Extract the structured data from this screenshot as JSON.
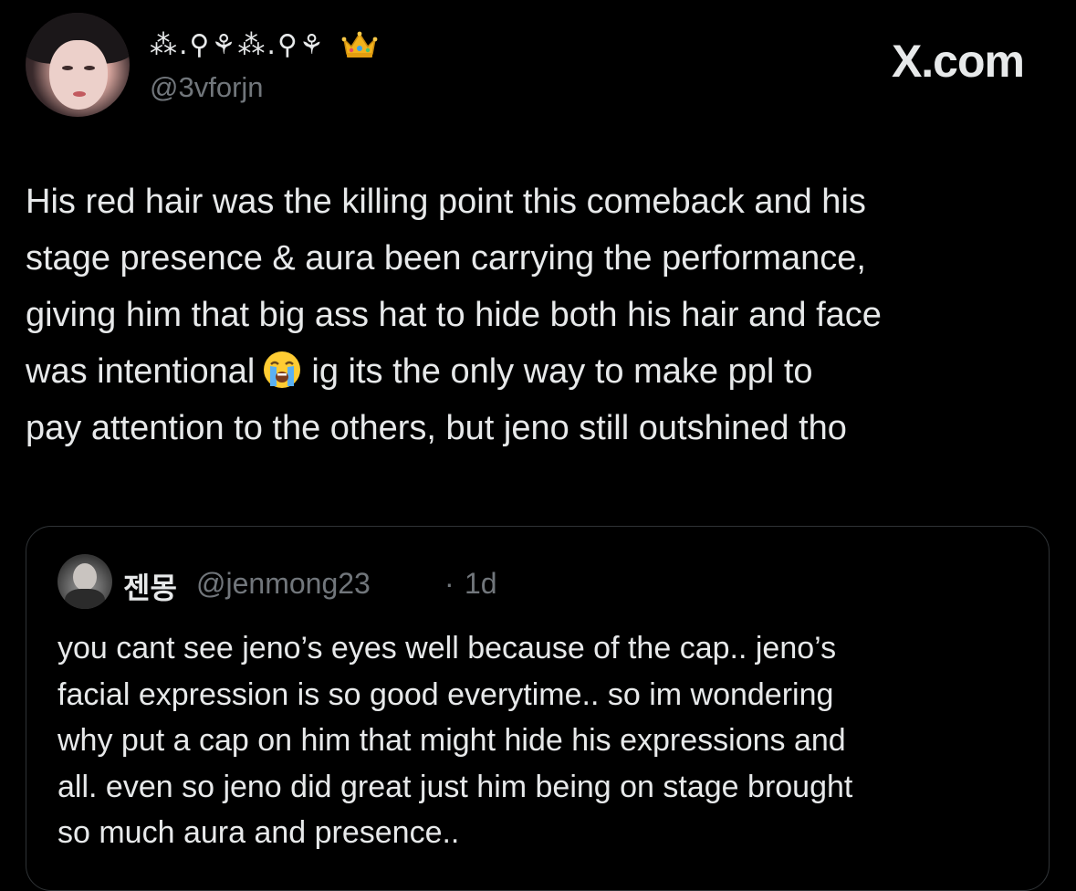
{
  "brand": {
    "label": "X.com"
  },
  "author": {
    "display_name": "⁂.⚲⚘⁂.⚲⚘",
    "handle": "@3vforjn",
    "badge_icon": "crown-icon",
    "avatar_icon": "profile-photo-avatar"
  },
  "tweet": {
    "lines": [
      "His red hair was the killing point this comeback and his",
      "stage presence & aura been carrying the performance,",
      "giving him that big ass hat to hide both his hair and face",
      "was intentional",
      "ig its the only way to make ppl to",
      "pay attention to the others, but jeno still outshined tho"
    ],
    "emoji_icon": "loudly-crying-face-icon"
  },
  "quote": {
    "display_name": "젠몽",
    "handle": "@jenmong23",
    "separator": "·",
    "time": "1d",
    "avatar_icon": "profile-photo-avatar",
    "lines": [
      "you cant see jeno’s eyes well because of the cap.. jeno’s",
      "facial expression is so good everytime.. so im wondering",
      "why put a cap on him that might hide his expressions and",
      "all. even so jeno did great just him being on stage brought",
      "so much aura and presence.."
    ]
  },
  "colors": {
    "background": "#000000",
    "text_primary": "#e7e9ea",
    "text_secondary": "#71767b",
    "border": "#2f3336"
  }
}
